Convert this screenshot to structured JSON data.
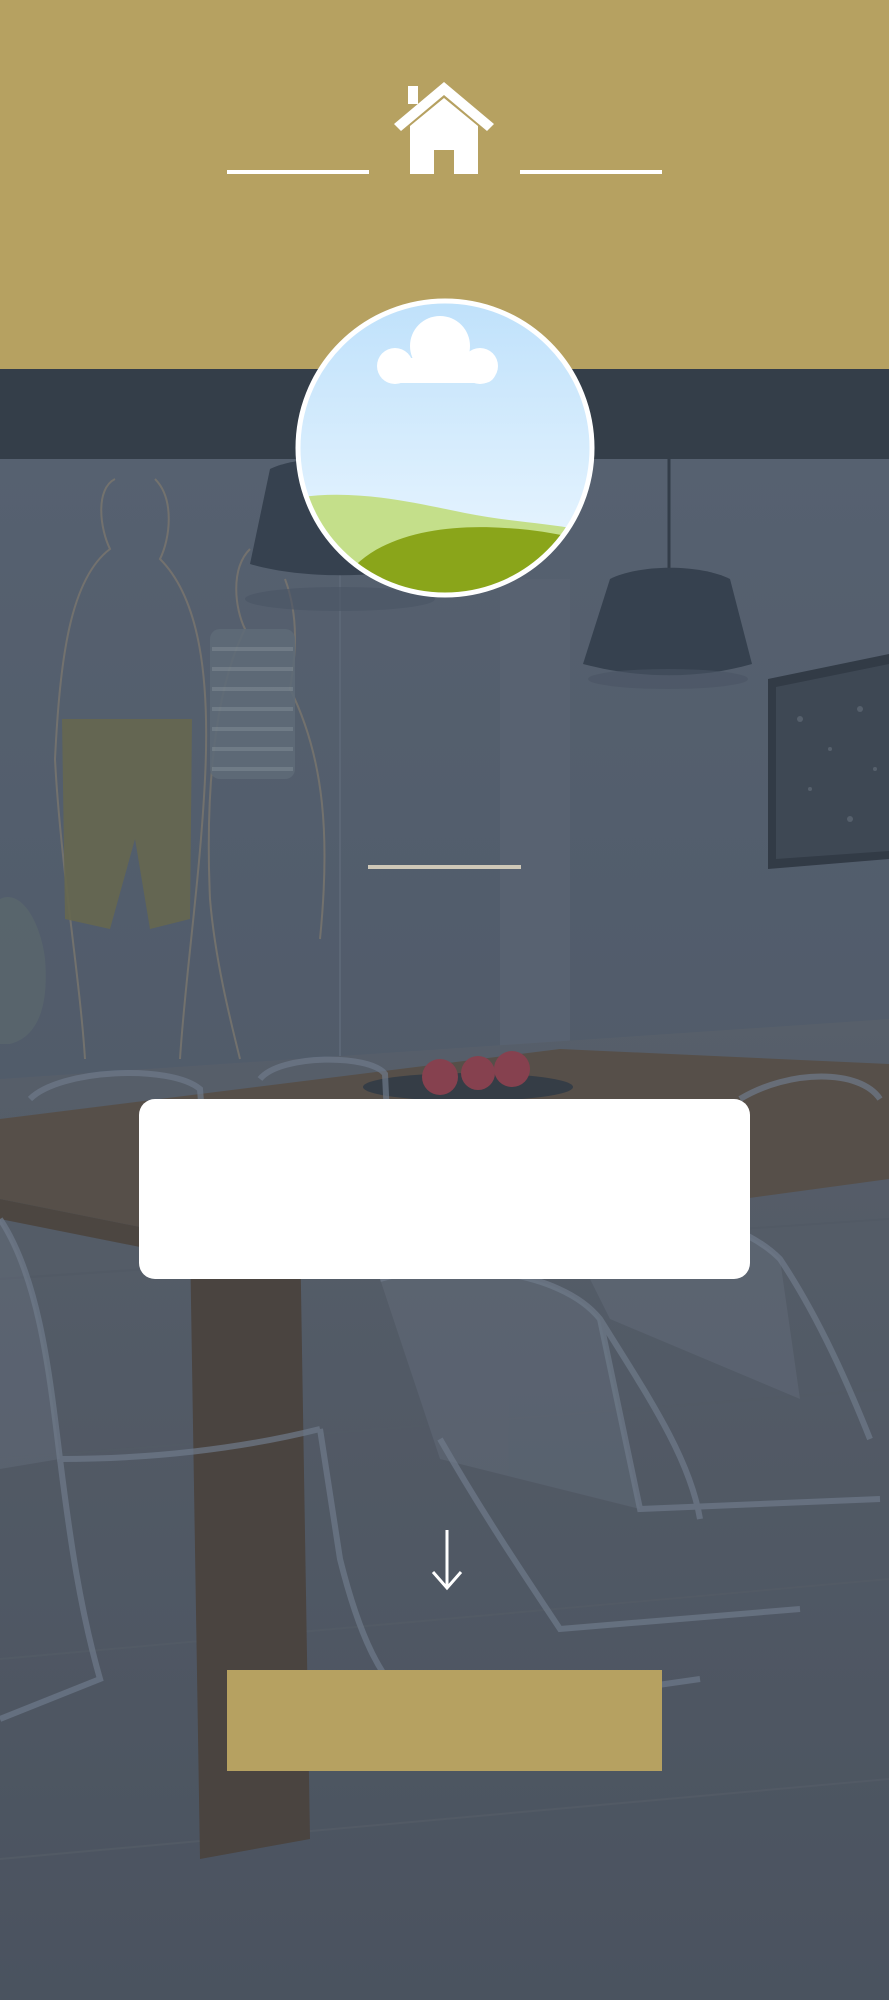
{
  "header": {
    "icon": "home-icon",
    "background_color": "#b6a161"
  },
  "profile": {
    "icon": "landscape-image-placeholder-icon"
  },
  "background": {
    "description_icon": "dining-room-photo"
  },
  "card": {
    "text": ""
  },
  "scroll": {
    "icon": "arrow-down-icon"
  },
  "cta": {
    "label": "",
    "color": "#b6a161"
  },
  "colors": {
    "accent": "#b6a161",
    "band": "#343e49",
    "overlay": "#4f5866"
  }
}
